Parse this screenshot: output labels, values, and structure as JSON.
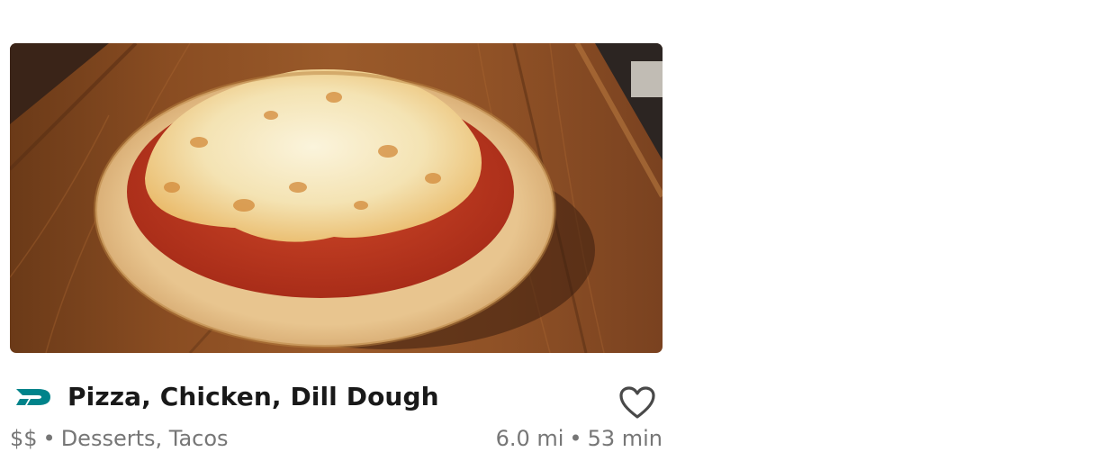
{
  "store": {
    "name": "Pizza, Chicken, Dill Dough",
    "price_range": "$$",
    "categories": "Desserts, Tacos",
    "distance": "6.0 mi",
    "eta": "53 min",
    "separator": "•"
  },
  "icons": {
    "pass": "dashpass-icon",
    "favorite": "heart-outline-icon"
  },
  "colors": {
    "dashpass_teal": "#00838A",
    "title_text": "#191919",
    "meta_text": "#767676"
  }
}
